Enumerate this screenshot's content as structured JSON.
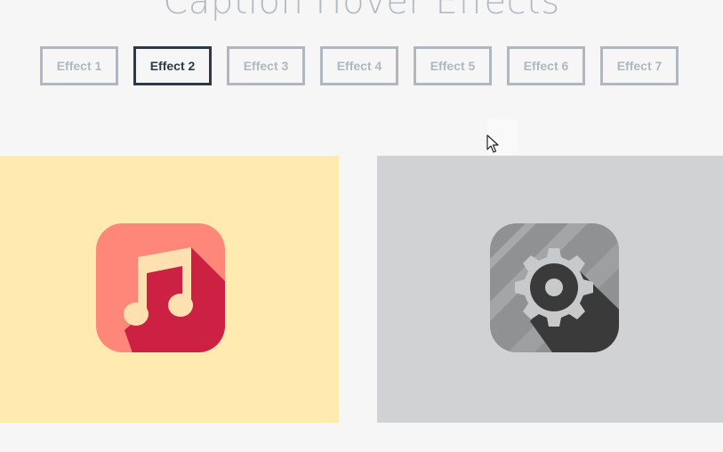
{
  "page": {
    "title": "Caption Hover Effects"
  },
  "tabs": [
    {
      "label": "Effect 1",
      "active": false
    },
    {
      "label": "Effect 2",
      "active": true
    },
    {
      "label": "Effect 3",
      "active": false
    },
    {
      "label": "Effect 4",
      "active": false
    },
    {
      "label": "Effect 5",
      "active": false
    },
    {
      "label": "Effect 6",
      "active": false
    },
    {
      "label": "Effect 7",
      "active": false
    }
  ],
  "grid": {
    "items": [
      {
        "icon": "music-note-icon",
        "background": "#ffeab0",
        "icon_color": "#ff877a",
        "shadow_color": "#cc2143"
      },
      {
        "icon": "gear-icon",
        "background": "#d0d2d4",
        "icon_color": "#8f9193",
        "shadow_color": "#3a3a3a"
      }
    ]
  },
  "colors": {
    "page_background": "#f6f6f6",
    "title": "#b4bac2",
    "tab_inactive": "#b0b7c0",
    "tab_active": "#2c3a47"
  }
}
